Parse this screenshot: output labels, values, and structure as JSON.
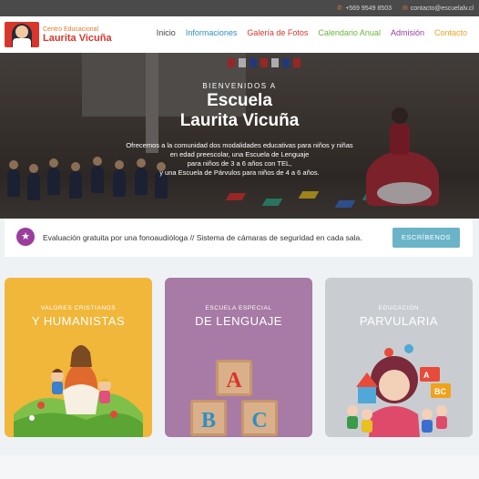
{
  "topbar": {
    "phone": "+569 9549 8503",
    "email": "contacto@escuelalv.cl",
    "phone_icon": "phone-icon",
    "email_icon": "envelope-icon"
  },
  "logo": {
    "line1": "Centro Educacional",
    "line2": "Laurita Vicuña"
  },
  "nav": [
    {
      "label": "Inicio",
      "color": "#444444"
    },
    {
      "label": "Informaciones",
      "color": "#2e8fc4"
    },
    {
      "label": "Galería de Fotos",
      "color": "#d9362b"
    },
    {
      "label": "Calendario Anual",
      "color": "#6ab33b"
    },
    {
      "label": "Admisión",
      "color": "#9a3d9c"
    },
    {
      "label": "Contacto",
      "color": "#f0a21c"
    }
  ],
  "hero": {
    "kicker": "BIENVENIDOS A",
    "title_line1": "Escuela",
    "title_line2": "Laurita Vicuña",
    "desc_lines": [
      "Ofrecemos a la comunidad dos modalidades educativas para niños y niñas",
      "en edad preescolar, una Escuela de Lenguaje",
      "para niños de 3 a 6 años con TEL,",
      "y una Escuela de Párvulos para niños de 4 a 6 años."
    ]
  },
  "notice": {
    "icon": "star-icon",
    "text": "Evaluación gratuita por una fonoaudióloga // Sistema de cámaras de seguridad en cada sala.",
    "button": "ESCRÍBENOS"
  },
  "cards": [
    {
      "kicker": "VALORES CRISTIANOS",
      "title": "Y HUMANISTAS",
      "color": "#f1b73a"
    },
    {
      "kicker": "ESCUELA ESPECIAL",
      "title": "DE LENGUAJE",
      "color": "#a77ba5"
    },
    {
      "kicker": "EDUCACIÓN",
      "title": "PARVULARIA",
      "color": "#c9cdd1"
    }
  ]
}
